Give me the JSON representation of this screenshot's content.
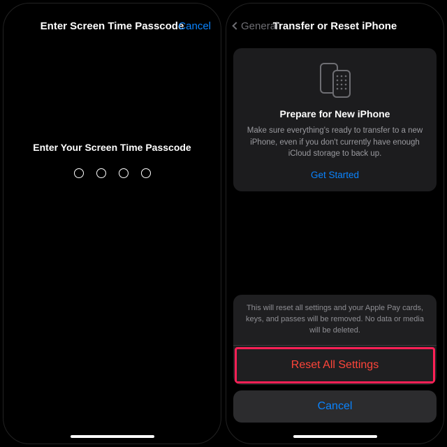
{
  "left": {
    "title": "Enter Screen Time Passcode",
    "cancel": "Cancel",
    "prompt": "Enter Your Screen Time Passcode",
    "dot_count": 4
  },
  "right": {
    "back_label": "General",
    "title": "Transfer or Reset iPhone",
    "card": {
      "title": "Prepare for New iPhone",
      "desc": "Make sure everything's ready to transfer to a new iPhone, even if you don't currently have enough iCloud storage to back up.",
      "link": "Get Started"
    },
    "sheet": {
      "message": "This will reset all settings and your Apple Pay cards, keys, and passes will be removed. No data or media will be deleted.",
      "destructive": "Reset All Settings",
      "cancel": "Cancel"
    }
  }
}
